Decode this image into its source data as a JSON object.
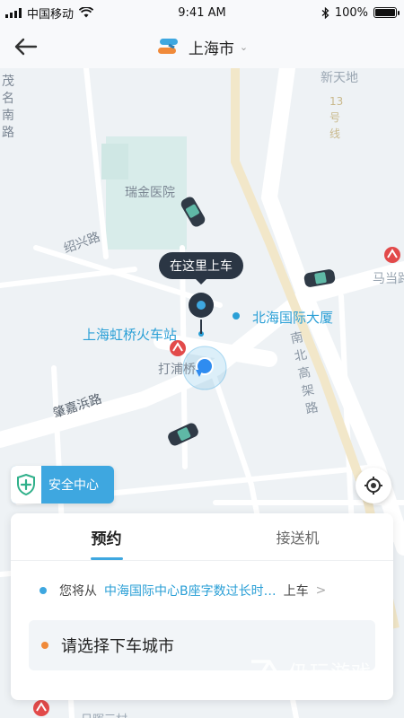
{
  "status": {
    "carrier": "中国移动",
    "time": "9:41 AM",
    "battery": "100%"
  },
  "nav": {
    "city": "上海市",
    "back_icon": "arrow-left-icon",
    "logo": "brand-logo"
  },
  "map": {
    "labels": {
      "xintiandi": "新天地",
      "maoming": "茂名南路",
      "ruijin": "瑞金医院",
      "line13": "13号线",
      "shaoxing": "绍兴路",
      "madang": "马当路",
      "north_plaza": "北海国际大厦",
      "hongqiao": "上海虹桥火车站",
      "dapuqiao": "打浦桥",
      "nanbei": "南北高架路",
      "zhaojiabang": "肇嘉浜路",
      "bottom_partial": "日晖三村"
    },
    "pickup_tooltip": "在这里上车"
  },
  "safety": {
    "label": "安全中心"
  },
  "card": {
    "tabs": [
      {
        "label": "预约",
        "active": true
      },
      {
        "label": "接送机",
        "active": false
      }
    ],
    "from": {
      "prefix": "您将从",
      "place": "中海国际中心B座字数过长时…",
      "suffix": "上车"
    },
    "to": {
      "placeholder": "请选择下车城市"
    }
  },
  "watermark": {
    "title": "仍玩游戏",
    "subtitle": "Rengwan Games"
  },
  "colors": {
    "accent": "#3ea7e0",
    "from_dot": "#3ea7e0",
    "to_dot": "#f08a3a",
    "tooltip_bg": "#2b3644",
    "metro": "#e24a4a"
  }
}
